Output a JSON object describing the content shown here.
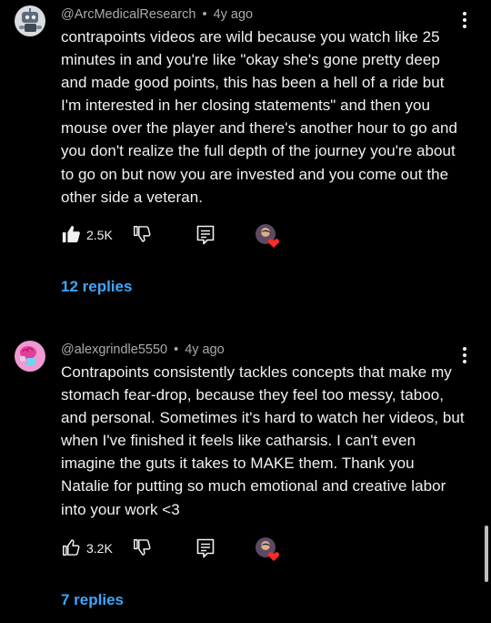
{
  "comments": [
    {
      "author": "@ArcMedicalResearch",
      "separator": "•",
      "time": "4y ago",
      "text": "contrapoints videos are wild because you watch like 25 minutes in and you're like \"okay she's gone pretty deep and made good points, this has been a hell of a ride but I'm interested in her closing statements\" and then you mouse over the player and there's another hour to go and you don't realize the full depth of the journey you're about to go on but now you are invested and you come out the other side a veteran.",
      "likes": "2.5K",
      "liked": true,
      "replies": "12 replies",
      "avatar_icon": "robot-avatar-icon"
    },
    {
      "author": "@alexgrindle5550",
      "separator": "•",
      "time": "4y ago",
      "text": "Contrapoints consistently tackles concepts that make my stomach fear-drop, because they feel too messy, taboo, and personal. Sometimes it's hard to watch her videos, but when I've finished it feels like catharsis. I can't even imagine the guts it takes to MAKE them. Thank you Natalie for putting so much emotional and creative labor into your work <3",
      "likes": "3.2K",
      "liked": false,
      "replies": "7 replies",
      "avatar_icon": "brain-avatar-icon"
    }
  ],
  "colors": {
    "background": "#000000",
    "text": "#f1f1f1",
    "meta": "#aaaaaa",
    "replies": "#3ea6ff",
    "heart": "#ff2a2a"
  }
}
